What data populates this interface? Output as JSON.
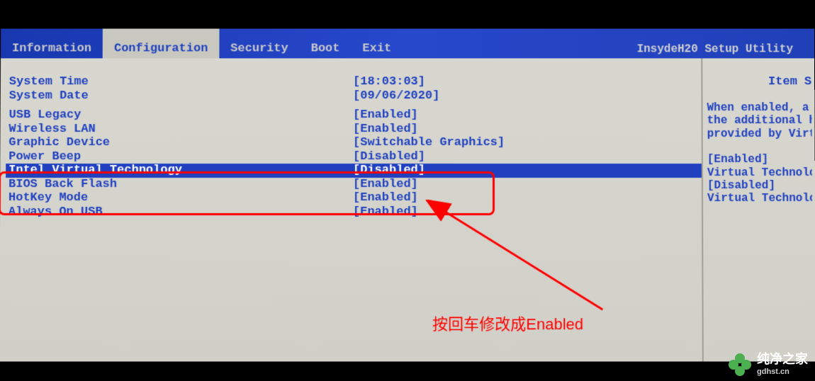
{
  "utility_name": "InsydeH20 Setup Utility",
  "tabs": {
    "information": "Information",
    "configuration": "Configuration",
    "security": "Security",
    "boot": "Boot",
    "exit": "Exit"
  },
  "settings": {
    "system_time": {
      "label": "System Time",
      "value": "[18:03:03]"
    },
    "system_date": {
      "label": "System Date",
      "value": "[09/06/2020]"
    },
    "usb_legacy": {
      "label": "USB Legacy",
      "value": "[Enabled]"
    },
    "wireless_lan": {
      "label": "Wireless LAN",
      "value": "[Enabled]"
    },
    "graphic_device": {
      "label": "Graphic Device",
      "value": "[Switchable Graphics]"
    },
    "power_beep": {
      "label": "Power Beep",
      "value": "[Disabled]"
    },
    "intel_vt": {
      "label": "Intel Virtual Technology",
      "value": "[Disabled]"
    },
    "bios_back_flash": {
      "label": "BIOS Back Flash",
      "value": "[Enabled]"
    },
    "hotkey_mode": {
      "label": "HotKey Mode",
      "value": "[Enabled]"
    },
    "always_on_usb": {
      "label": "Always On USB",
      "value": "[Enabled]"
    }
  },
  "help": {
    "title": "Item S",
    "line1": "When enabled, a V",
    "line2": "the additional ha",
    "line3": "provided by Virtu",
    "opt1": "[Enabled]",
    "opt2": "Virtual Technology",
    "opt3": "[Disabled]",
    "opt4": "Virtual Technology"
  },
  "annotation": "按回车修改成Enabled",
  "watermark": {
    "name": "纯净之家",
    "url": "gdhst.cn"
  }
}
